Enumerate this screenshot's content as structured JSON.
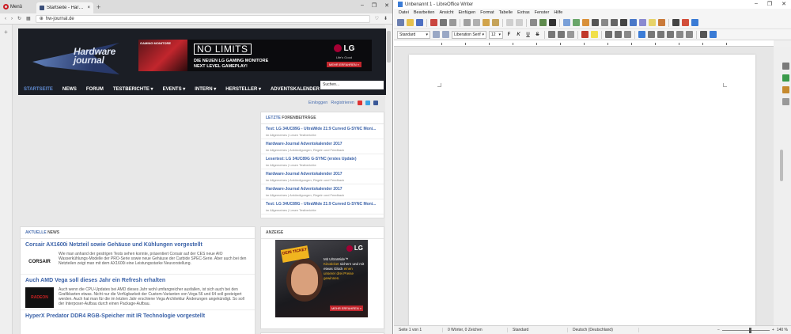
{
  "opera": {
    "menu_label": "Menü",
    "tab_title": "Startseite - Hardware-Jou",
    "tab_close": "×",
    "new_tab": "+",
    "window_buttons": [
      "‒",
      "❐",
      "✕"
    ],
    "url": "hw-journal.de",
    "sidebar_add": "+"
  },
  "site": {
    "logo_line1": "Hardware",
    "logo_line2": "journal",
    "ad": {
      "corner": "GAMING MONITORE",
      "headline": "NO LIMITS",
      "sub1": "DIE NEUEN LG GAMING MONITORE",
      "sub2": "NEXT LEVEL GAMEPLAY!",
      "brand": "LG",
      "tagline": "Life's Good",
      "cta": "MEHR ERFAHREN »"
    },
    "nav": [
      "STARTSEITE",
      "NEWS",
      "FORUM",
      "TESTBERICHTE ▾",
      "EVENTS ▾",
      "INTERN ▾",
      "HERSTELLER ▾",
      "ADVENTSKALENDER"
    ],
    "search_placeholder": "Suchen...",
    "login": "Einloggen",
    "register": "Registrieren"
  },
  "forum": {
    "header_a": "LETZTE",
    "header_b": "FORENBEITRÄGE",
    "items": [
      {
        "title": "Test: LG 34UC89G - UltraWide 21:9 Curved G-SYNC Moni...",
        "meta": "im Allgemeines | Lesen Testberichte"
      },
      {
        "title": "Hardware-Journal Adventskalender 2017",
        "meta": "im Allgemeines | Ankündigungen, Regeln und Feedback"
      },
      {
        "title": "Lesertest: LG 34UC89G G-SYNC (erstes Update)",
        "meta": "im Allgemeines | Lesen Testberichte"
      },
      {
        "title": "Hardware-Journal Adventskalender 2017",
        "meta": "im Allgemeines | Ankündigungen, Regeln und Feedback"
      },
      {
        "title": "Hardware-Journal Adventskalender 2017",
        "meta": "im Allgemeines | Ankündigungen, Regeln und Feedback"
      },
      {
        "title": "Test: LG 34UC89G - UltraWide 21:9 Curved G-SYNC Moni...",
        "meta": "im Allgemeines | Lesen Testberichte"
      }
    ]
  },
  "news": {
    "header_a": "AKTUELLE",
    "header_b": "NEWS",
    "articles": [
      {
        "title": "Corsair AX1600i Netzteil sowie Gehäuse und Kühlungen vorgestellt",
        "thumb": "CORSAIR",
        "body": "Wie man anhand der gestrigen Tests sehen konnte, präsentiert Corsair auf der CES neue AIO Wasserkühlungs-Modelle der PRO-Serie sowie neue Gehäuse der Carbide SPEC-Serie. Aber auch bei den Netzteilen zeigt man mit dem AX1600i eine Leistungsstarke Neuvorstellung."
      },
      {
        "title": "Auch AMD Vega soll dieses Jahr ein Refresh erhalten",
        "thumb": "RADEON",
        "body": "Auch wenn die CPU-Updates bei AMD dieses Jahr wohl umfangreicher ausfallen, ist sich auch bei den Grafikkarten etwas. Nicht nur die Verfügbarkeit der Custom-Varianten von Vega 56 und 64 soll gesteigert werden. Auch hat man für die im letzten Jahr erschiene Vega Architektur Änderungen angekündigt. So soll der Interposer-Aufbau durch einen Package-Aufbau."
      },
      {
        "title": "HyperX Predator DDR4 RGB-Speicher mit IR Technologie vorgestellt",
        "thumb": "",
        "body": ""
      }
    ]
  },
  "anzeige": {
    "header": "ANZEIGE",
    "ticket": "DEIN TICKET",
    "brand": "LG",
    "text_a": "Mit UltraWide™",
    "text_em": "Kinoticket",
    "text_b": "sichern und mit etwas Glück",
    "text_em2": "einen unserer drei Preise gewinnen.",
    "button": "MEHR ERFAHREN »"
  },
  "writer": {
    "title": "Unbenannt 1 - LibreOffice Writer",
    "window_buttons": [
      "‒",
      "❐",
      "✕"
    ],
    "menu": [
      "Datei",
      "Bearbeiten",
      "Ansicht",
      "Einfügen",
      "Format",
      "Tabelle",
      "Extras",
      "Fenster",
      "Hilfe"
    ],
    "paragraph_style": "Standard",
    "font_name": "Liberation Serif",
    "font_size": "12",
    "format_buttons": [
      "F",
      "K",
      "U",
      "S"
    ],
    "status": {
      "page": "Seite 1 von 1",
      "words": "0 Wörter, 0 Zeichen",
      "style": "Standard",
      "language": "Deutsch (Deutschland)",
      "zoom": "140 %"
    }
  },
  "colors": {
    "accent_blue": "#3b62a8",
    "lg_red": "#a50034",
    "opera_red": "#cc1b23",
    "header_dark": "#1b1e25"
  }
}
